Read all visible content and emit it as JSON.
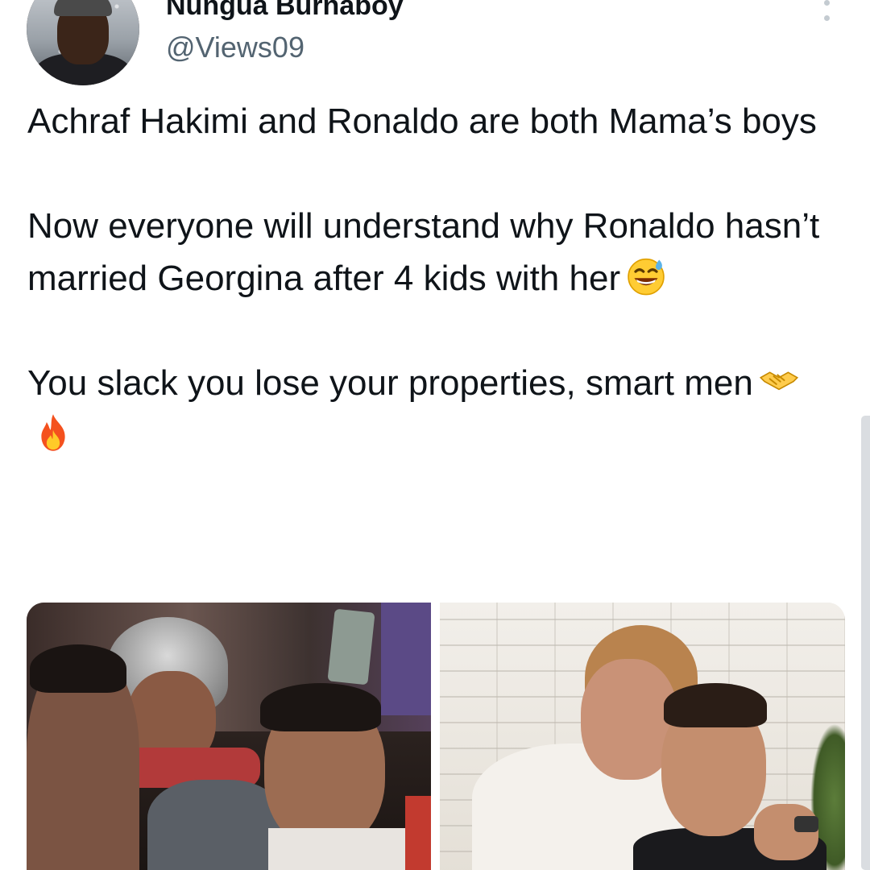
{
  "tweet": {
    "author_name": "Nungua Burnaboy",
    "author_handle": "@Views09",
    "avatar_label": "avatar",
    "more_icon": "more-vertical-icon",
    "paragraphs": [
      {
        "text": "Achraf Hakimi and Ronaldo are both Mama’s boys",
        "emoji": []
      },
      {
        "text": "Now everyone will understand why Ronaldo hasn’t married Georgina after 4 kids with her",
        "emoji": [
          "sweat-smile-emoji"
        ]
      },
      {
        "text": "You slack you lose your properties, smart men",
        "emoji": [
          "handshake-emoji",
          "fire-emoji"
        ]
      }
    ]
  },
  "media": {
    "photos": [
      {
        "name": "photo-hakimi-mother",
        "alt": ""
      },
      {
        "name": "photo-ronaldo-mother",
        "alt": ""
      }
    ]
  },
  "colors": {
    "text_primary": "#0f1419",
    "text_secondary": "#536471",
    "background": "#ffffff",
    "scrollbar": "#dadde1"
  }
}
